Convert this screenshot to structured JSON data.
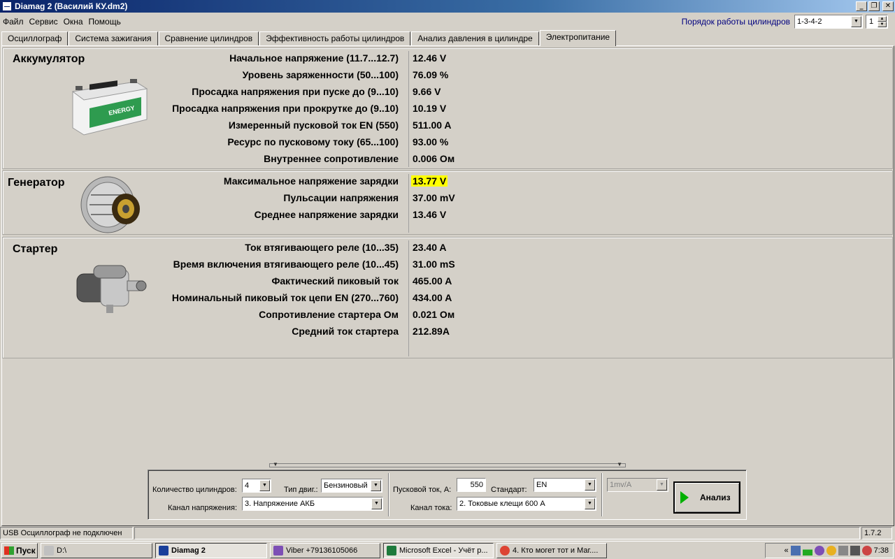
{
  "window": {
    "title": "Diamag 2 (Василий КУ.dm2)"
  },
  "menu": [
    "Файл",
    "Сервис",
    "Окна",
    "Помощь"
  ],
  "cylinder_order": {
    "label": "Порядок работы цилиндров",
    "value": "1-3-4-2",
    "spin": "1"
  },
  "tabs": [
    {
      "label": "Осциллограф"
    },
    {
      "label": "Система зажигания"
    },
    {
      "label": "Сравнение цилиндров"
    },
    {
      "label": "Эффективность работы цилиндров"
    },
    {
      "label": "Анализ давления в цилиндре"
    },
    {
      "label": "Электропитание"
    }
  ],
  "battery": {
    "title": "Аккумулятор",
    "image_label": "ENERGY",
    "rows": [
      {
        "label": "Начальное напряжение (11.7...12.7)",
        "value": "12.46 V"
      },
      {
        "label": "Уровень заряженности (50...100)",
        "value": "76.09 %"
      },
      {
        "label": "Просадка напряжения при пуске до (9...10)",
        "value": "9.66 V"
      },
      {
        "label": "Просадка напряжения при прокрутке до  (9..10)",
        "value": "10.19 V"
      },
      {
        "label": "Измеренный пусковой ток  EN (550)",
        "value": "511.00 A"
      },
      {
        "label": "Ресурс по пусковому току (65...100)",
        "value": "93.00 %"
      },
      {
        "label": "Внутреннее сопротивление",
        "value": "0.006 Ом"
      }
    ]
  },
  "generator": {
    "title": "Генератор",
    "rows": [
      {
        "label": "Максимальное напряжение зарядки",
        "value": "13.77 V",
        "highlight": true
      },
      {
        "label": "Пульсации напряжения",
        "value": "37.00 mV"
      },
      {
        "label": "Среднее напряжение зарядки",
        "value": "13.46 V"
      }
    ]
  },
  "starter": {
    "title": "Стартер",
    "rows": [
      {
        "label": "Ток втягивающего реле (10...35)",
        "value": "23.40 A"
      },
      {
        "label": "Время включения втягивающего реле (10...45)",
        "value": "31.00 mS"
      },
      {
        "label": "Фактический пиковый ток",
        "value": "465.00 A"
      },
      {
        "label": "Номинальный пиковый ток цепи EN (270...760)",
        "value": "434.00 A"
      },
      {
        "label": "Сопротивление стартера Ом",
        "value": "0.021 Ом"
      },
      {
        "label": "Средний ток стартера",
        "value": "212.89A"
      }
    ]
  },
  "controls": {
    "cylinders_label": "Количество цилиндров:",
    "cylinders_value": "4",
    "engine_type_label": "Тип двиг.:",
    "engine_type_value": "Бензиновый",
    "voltage_channel_label": "Канал напряжения:",
    "voltage_channel_value": "3. Напряжение АКБ",
    "start_current_label": "Пусковой ток, А:",
    "start_current_value": "550",
    "standard_label": "Стандарт:",
    "standard_value": "EN",
    "current_channel_label": "Канал тока:",
    "current_channel_value": "2. Токовые клещи 600 А",
    "scale_value": "1mv/A",
    "analyze_label": "Анализ"
  },
  "status": {
    "left": "USB Осциллограф не подключен",
    "version": "1.7.2"
  },
  "taskbar": {
    "start": "Пуск",
    "tasks": [
      {
        "label": "D:\\",
        "color": "#c0c0c0"
      },
      {
        "label": "Diamag 2",
        "color": "#1a3f9a",
        "active": true
      },
      {
        "label": "Viber +79136105066",
        "color": "#7d4fb5"
      },
      {
        "label": "Microsoft Excel - Учёт р...",
        "color": "#1e7a3c"
      },
      {
        "label": "4. Кто могет тот и Маг....",
        "color": "#dd4433"
      }
    ],
    "clock": "7:38",
    "tray_chevron": "«"
  }
}
